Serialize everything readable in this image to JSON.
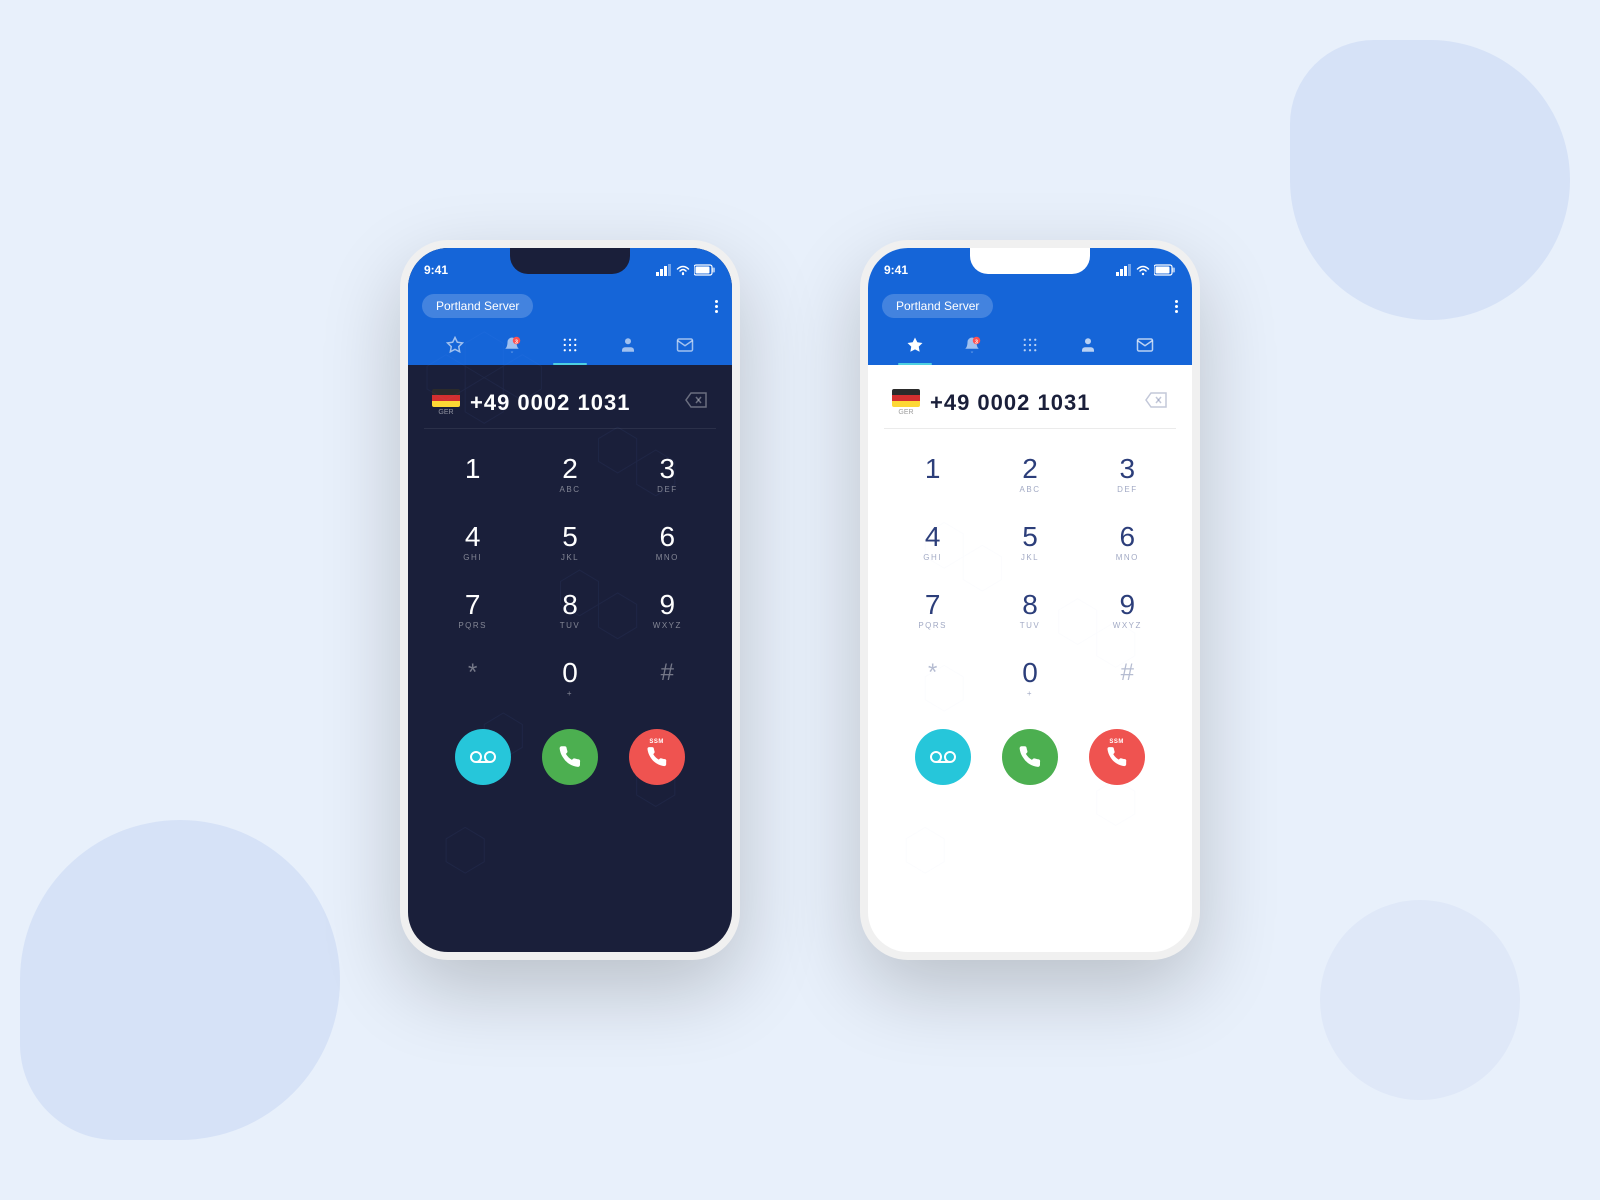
{
  "page": {
    "bg_color": "#e8f0fb"
  },
  "phone_dark": {
    "status_time": "9:41",
    "header": {
      "server_label": "Portland Server",
      "more_label": "⋮"
    },
    "nav": {
      "tabs": [
        {
          "id": "favorites",
          "icon": "☆",
          "active": false
        },
        {
          "id": "recents",
          "icon": "🔔",
          "active": false,
          "badge": "3"
        },
        {
          "id": "keypad",
          "icon": "⠿",
          "active": true
        },
        {
          "id": "contacts",
          "icon": "👤",
          "active": false
        },
        {
          "id": "messages",
          "icon": "✉",
          "active": false
        }
      ]
    },
    "dialer": {
      "country": "GER",
      "phone_number": "+49 0002 1031",
      "keys": [
        {
          "number": "1",
          "letters": ""
        },
        {
          "number": "2",
          "letters": "ABC"
        },
        {
          "number": "3",
          "letters": "DEF"
        },
        {
          "number": "4",
          "letters": "GHI"
        },
        {
          "number": "5",
          "letters": "JKL"
        },
        {
          "number": "6",
          "letters": "MNO"
        },
        {
          "number": "7",
          "letters": "PQRS"
        },
        {
          "number": "8",
          "letters": "TUV"
        },
        {
          "number": "9",
          "letters": "WXYZ"
        },
        {
          "number": "*",
          "letters": ""
        },
        {
          "number": "0",
          "letters": "+"
        },
        {
          "number": "#",
          "letters": ""
        }
      ],
      "actions": {
        "voicemail_icon": "⊙⊙",
        "call_icon": "📞",
        "ssm_label": "SSM"
      }
    }
  },
  "phone_light": {
    "status_time": "9:41",
    "header": {
      "server_label": "Portland Server",
      "more_label": "⋮"
    },
    "nav": {
      "tabs": [
        {
          "id": "favorites",
          "icon": "★",
          "active": true
        },
        {
          "id": "recents",
          "icon": "🔔",
          "active": false,
          "badge": "3"
        },
        {
          "id": "keypad",
          "icon": "⠿",
          "active": false
        },
        {
          "id": "contacts",
          "icon": "👤",
          "active": false
        },
        {
          "id": "messages",
          "icon": "✉",
          "active": false
        }
      ]
    },
    "dialer": {
      "country": "GER",
      "phone_number": "+49 0002 1031",
      "keys": [
        {
          "number": "1",
          "letters": ""
        },
        {
          "number": "2",
          "letters": "ABC"
        },
        {
          "number": "3",
          "letters": "DEF"
        },
        {
          "number": "4",
          "letters": "GHI"
        },
        {
          "number": "5",
          "letters": "JKL"
        },
        {
          "number": "6",
          "letters": "MNO"
        },
        {
          "number": "7",
          "letters": "PQRS"
        },
        {
          "number": "8",
          "letters": "TUV"
        },
        {
          "number": "9",
          "letters": "WXYZ"
        },
        {
          "number": "*",
          "letters": ""
        },
        {
          "number": "0",
          "letters": "+"
        },
        {
          "number": "#",
          "letters": ""
        }
      ],
      "actions": {
        "voicemail_icon": "⊙⊙",
        "call_icon": "📞",
        "ssm_label": "SSM"
      }
    }
  }
}
